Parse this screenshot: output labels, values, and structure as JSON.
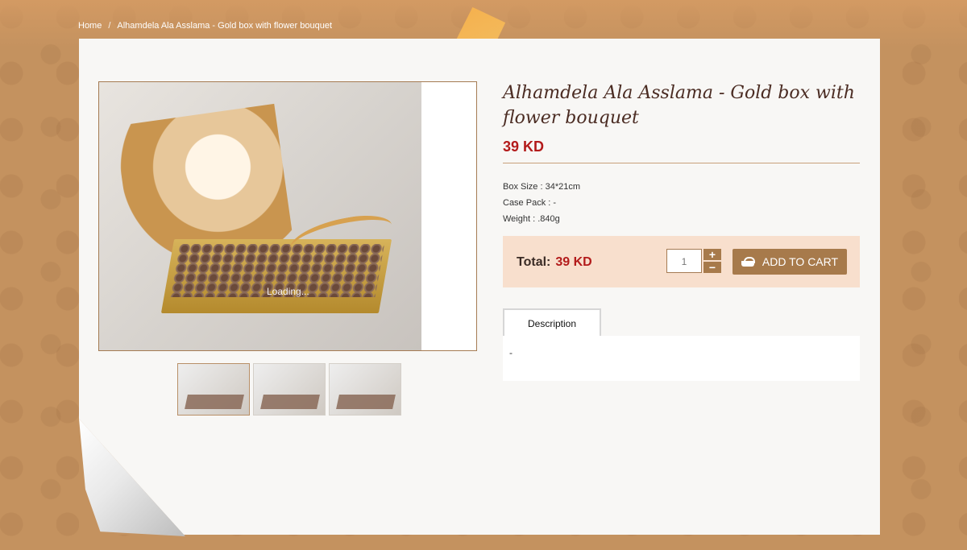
{
  "breadcrumb": {
    "home": "Home",
    "separator": "/",
    "current": "Alhamdela Ala Asslama - Gold box with flower bouquet"
  },
  "product": {
    "title": "Alhamdela Ala Asslama - Gold box with flower bouquet",
    "price": "39 KD",
    "specs": {
      "box_size": "Box Size : 34*21cm",
      "case_pack": "Case Pack : -",
      "weight": "Weight : .840g"
    }
  },
  "gallery": {
    "loading_text": "Loading...",
    "thumbnails": [
      "thumb-1",
      "thumb-2",
      "thumb-3"
    ]
  },
  "cart": {
    "total_label": "Total:",
    "total_amount": "39 KD",
    "quantity": "1",
    "increment": "+",
    "decrement": "−",
    "add_button": "ADD TO CART"
  },
  "tabs": {
    "description_label": "Description",
    "description_content": "-"
  },
  "colors": {
    "accent": "#a77a4b",
    "price": "#b31b1b",
    "cart_bg": "#f8dfcd"
  },
  "icons": {
    "add_to_cart": "basket-icon"
  }
}
